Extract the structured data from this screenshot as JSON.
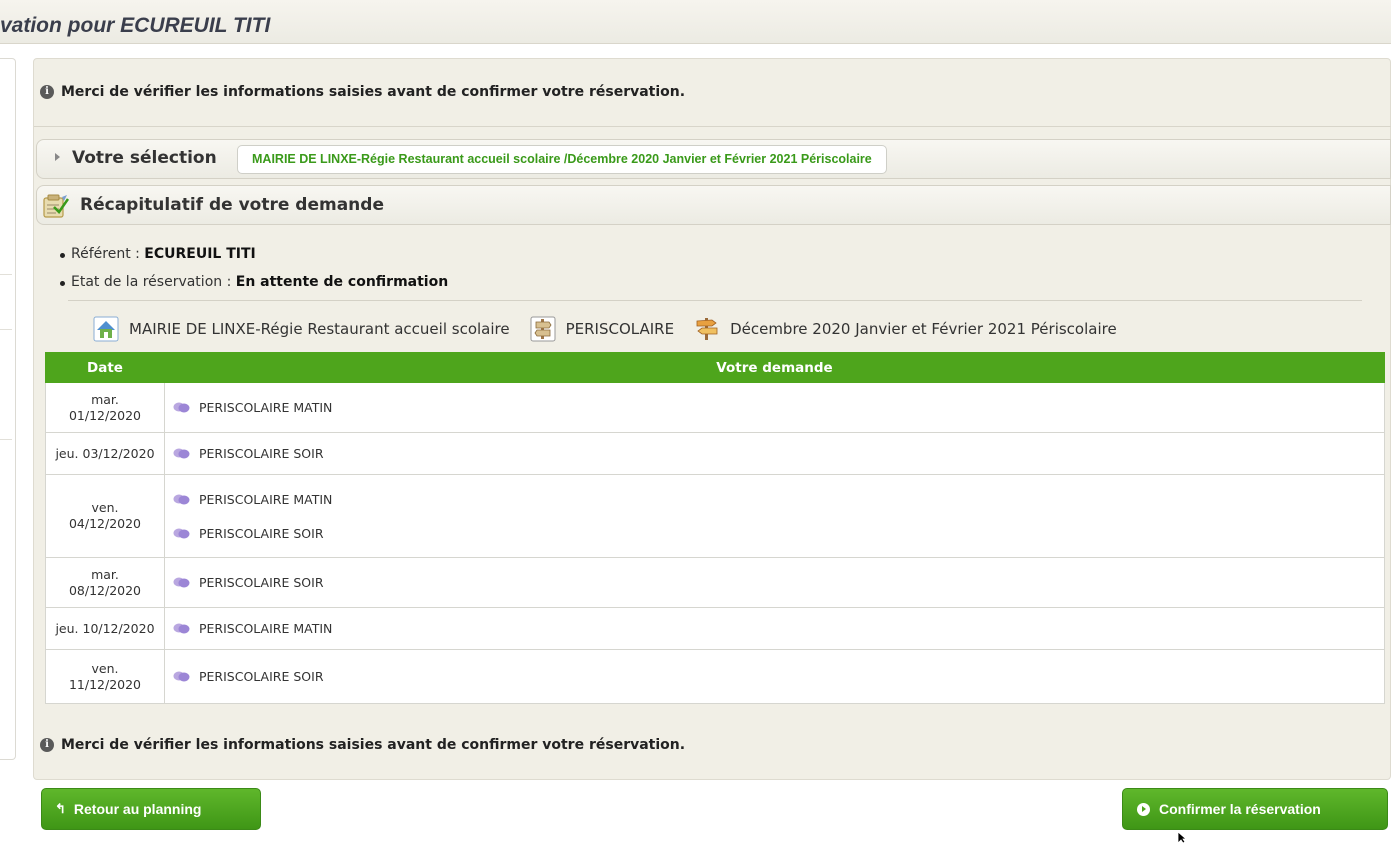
{
  "header": {
    "title": "vation pour ECUREUIL TITI"
  },
  "notice": {
    "top_text": "Merci de vérifier les informations saisies avant de confirmer votre réservation.",
    "bottom_text": "Merci de vérifier les informations saisies avant de confirmer votre réservation."
  },
  "selection": {
    "label": "Votre sélection",
    "value": "MAIRIE DE LINXE-Régie Restaurant accueil scolaire /Décembre 2020 Janvier et Février 2021 Périscolaire"
  },
  "recap": {
    "title": "Récapitulatif de votre demande",
    "referent_label": "Référent : ",
    "referent_value": "ECUREUIL TITI",
    "status_label": "Etat de la réservation : ",
    "status_value": "En attente de confirmation"
  },
  "breadcrumb": {
    "structure": "MAIRIE DE LINXE-Régie Restaurant accueil scolaire",
    "activity": "PERISCOLAIRE",
    "period": "Décembre 2020 Janvier et Février 2021 Périscolaire",
    "icons": [
      "house-icon",
      "activity-sign-icon",
      "signpost-icon"
    ]
  },
  "table": {
    "headers": {
      "date": "Date",
      "request": "Votre demande"
    },
    "rows": [
      {
        "date_day": "mar.",
        "date": "01/12/2020",
        "requests": [
          "PERISCOLAIRE MATIN"
        ]
      },
      {
        "date_inline": "jeu. 03/12/2020",
        "requests": [
          "PERISCOLAIRE SOIR"
        ]
      },
      {
        "date_day": "ven.",
        "date": "04/12/2020",
        "requests": [
          "PERISCOLAIRE MATIN",
          "PERISCOLAIRE SOIR"
        ]
      },
      {
        "date_day": "mar.",
        "date": "08/12/2020",
        "requests": [
          "PERISCOLAIRE SOIR"
        ]
      },
      {
        "date_inline": "jeu. 10/12/2020",
        "requests": [
          "PERISCOLAIRE MATIN"
        ]
      },
      {
        "date_day": "ven.",
        "date": "11/12/2020",
        "requests": [
          "PERISCOLAIRE SOIR"
        ]
      }
    ]
  },
  "buttons": {
    "back": "Retour au planning",
    "confirm": "Confirmer la réservation"
  },
  "colors": {
    "accent_green": "#4ea51c",
    "pill_text_green": "#3a9a1a",
    "panel_bg": "#f1efe6"
  }
}
